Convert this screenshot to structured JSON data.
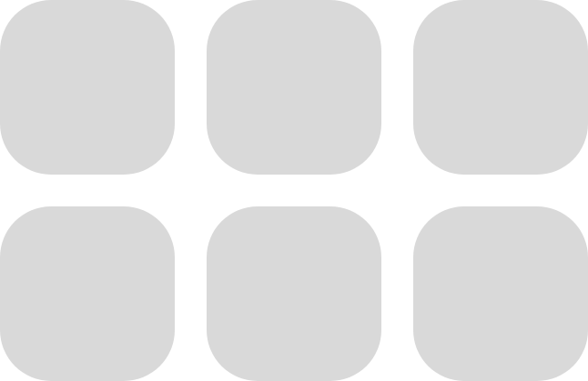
{
  "colors": {
    "background": "#ffffff",
    "tile": "#d9d9d9"
  },
  "grid": {
    "tiles": [
      {
        "id": "tile-1"
      },
      {
        "id": "tile-2"
      },
      {
        "id": "tile-3"
      },
      {
        "id": "tile-4"
      },
      {
        "id": "tile-5"
      },
      {
        "id": "tile-6"
      }
    ]
  }
}
